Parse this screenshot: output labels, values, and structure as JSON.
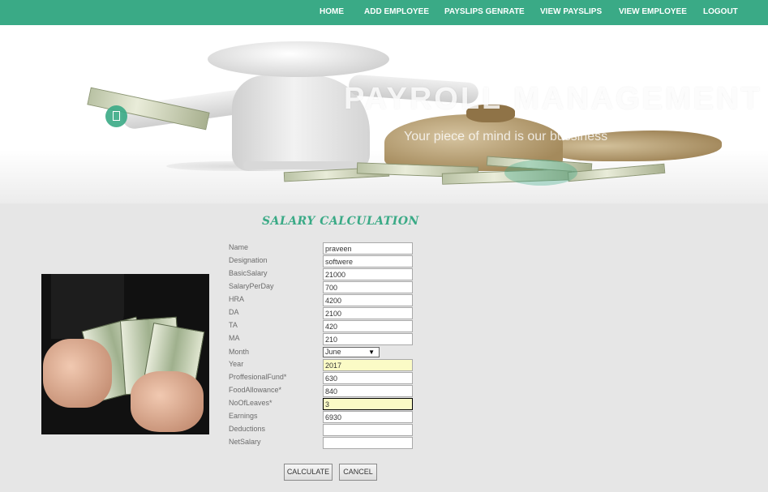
{
  "nav": {
    "items": [
      "HOME",
      "ADD EMPLOYEE",
      "PAYSLIPS GENRATE",
      "VIEW PAYSLIPS",
      "VIEW EMPLOYEE",
      "LOGOUT"
    ]
  },
  "hero": {
    "title": "PAYROLL MANAGEMENT",
    "subtitle": "Your piece of mind is our bussiness"
  },
  "form": {
    "title": "SALARY CALCULATION",
    "fields": [
      {
        "label": "Name",
        "value": ""
      },
      {
        "label": "Designation",
        "value": ""
      },
      {
        "label": "BasicSalary",
        "value": ""
      },
      {
        "label": "SalaryPerDay",
        "value": ""
      },
      {
        "label": "HRA",
        "value": ""
      },
      {
        "label": "DA",
        "value": ""
      },
      {
        "label": "TA",
        "value": ""
      },
      {
        "label": "MA",
        "value": ""
      },
      {
        "label": "Month",
        "value": "June"
      },
      {
        "label": "Year",
        "value": ""
      },
      {
        "label": "ProffesionalFund*",
        "value": ""
      },
      {
        "label": "FoodAllowance*",
        "value": ""
      },
      {
        "label": "NoOfLeaves*",
        "value": ""
      },
      {
        "label": "Earnings",
        "value": ""
      },
      {
        "label": "Deductions",
        "value": ""
      },
      {
        "label": "NetSalary",
        "value": ""
      }
    ],
    "values": {
      "name": "praveen",
      "designation": "softwere",
      "basic_salary": "21000",
      "salary_per_day": "700",
      "hra": "4200",
      "da": "2100",
      "ta": "420",
      "ma": "210",
      "month": "June",
      "year": "2017",
      "proffesional_fund": "630",
      "food_allowance": "840",
      "no_of_leaves": "3",
      "earnings": "6930",
      "deductions": "",
      "net_salary": ""
    },
    "buttons": {
      "calculate": "CALCULATE",
      "cancel": "CANCEL"
    }
  },
  "colors": {
    "accent": "#3aaa86",
    "highlight_input": "#fbfbc6",
    "page_background": "#e6e6e6"
  },
  "icons": {
    "slider_dot": "square-outline-icon",
    "select_caret": "caret-down-icon"
  }
}
